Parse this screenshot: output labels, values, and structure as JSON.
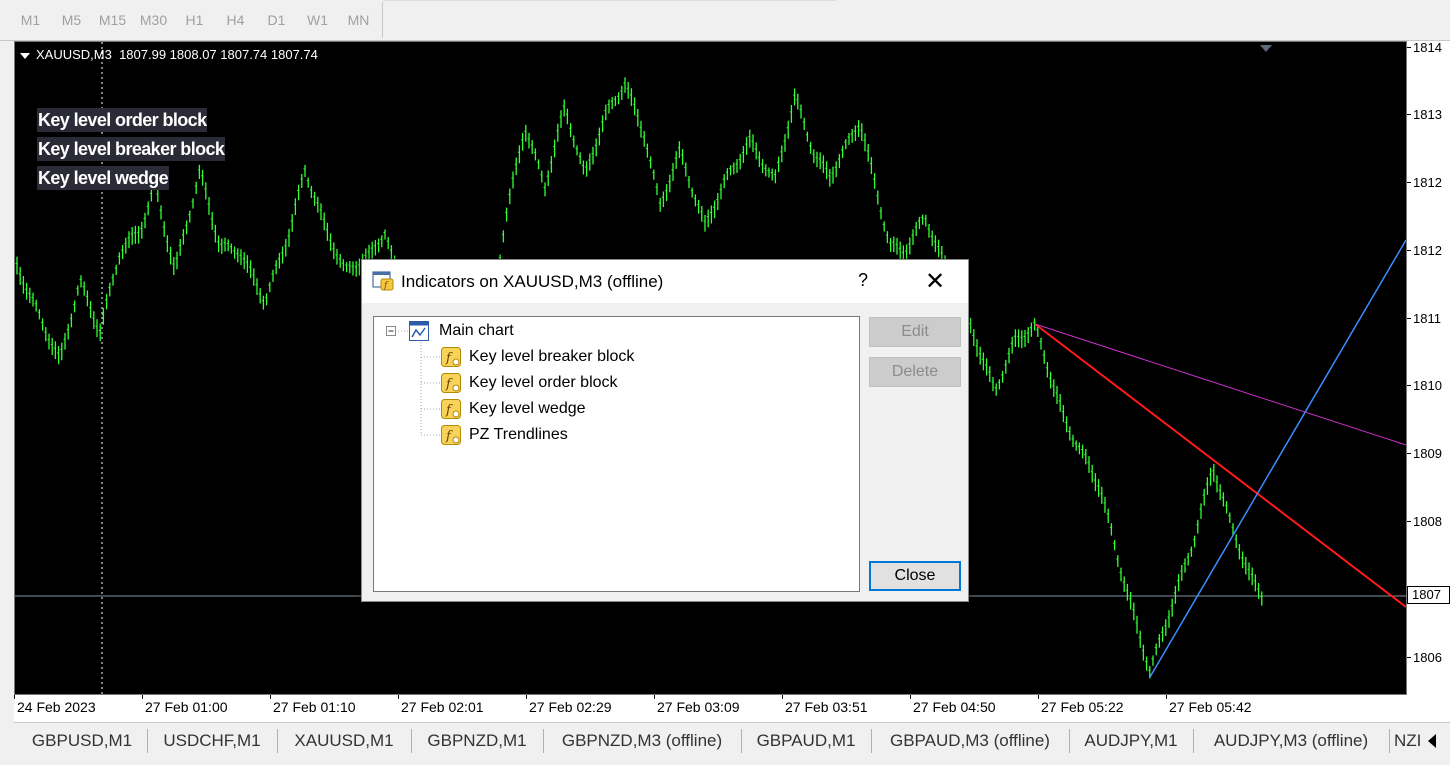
{
  "toolbar": {
    "timeframes": [
      "M1",
      "M5",
      "M15",
      "M30",
      "H1",
      "H4",
      "D1",
      "W1",
      "MN"
    ]
  },
  "chart": {
    "symbol_header": "XAUUSD,M3  1807.99 1808.07 1807.74 1807.74",
    "indicator_labels": [
      "Key level order block",
      "Key level breaker block",
      "Key level wedge"
    ],
    "price_ticks": [
      "1814",
      "1813",
      "1812",
      "1812",
      "1811",
      "1810",
      "1809",
      "1808",
      "1807",
      "1806"
    ],
    "current_price": "1807",
    "time_ticks": [
      "24 Feb 2023",
      "27 Feb 01:00",
      "27 Feb 01:10",
      "27 Feb 02:01",
      "27 Feb 02:29",
      "27 Feb 03:09",
      "27 Feb 03:51",
      "27 Feb 04:50",
      "27 Feb 05:22",
      "27 Feb 05:42"
    ],
    "colors": {
      "background": "#000000",
      "bars": "#33ff33",
      "trend_red": "#ff1a1a",
      "trend_magenta": "#cc33cc",
      "trend_blue": "#3a8fff",
      "crosshair": "#ffffff",
      "current_price_line": "#8090a0"
    }
  },
  "tabs": [
    "GBPUSD,M1",
    "USDCHF,M1",
    "XAUUSD,M1",
    "GBPNZD,M1",
    "GBPNZD,M3 (offline)",
    "GBPAUD,M1",
    "GBPAUD,M3 (offline)",
    "AUDJPY,M1",
    "AUDJPY,M3 (offline)",
    "NZI"
  ],
  "dialog": {
    "title": "Indicators on XAUUSD,M3 (offline)",
    "help": "?",
    "close_x": "✕",
    "tree_root": "Main chart",
    "indicators": [
      "Key level breaker block",
      "Key level order block",
      "Key level wedge",
      "PZ Trendlines"
    ],
    "buttons": {
      "edit": "Edit",
      "delete": "Delete",
      "close": "Close"
    }
  }
}
